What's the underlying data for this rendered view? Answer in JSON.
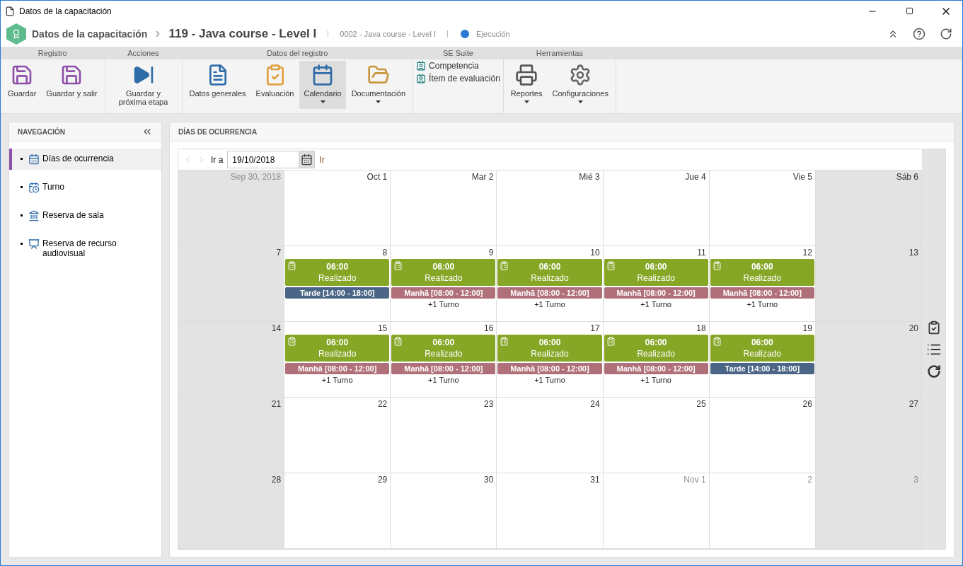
{
  "window": {
    "title": "Datos de la capacitación"
  },
  "header": {
    "breadcrumb": "Datos de la capacitación",
    "title": "119 - Java course - Level I",
    "code": "0002 - Java course - Level I",
    "stage": "Ejecución"
  },
  "ribbon": [
    {
      "label": "Registro",
      "items": [
        {
          "kind": "button",
          "label": "Guardar",
          "selected": false,
          "dropdown": false
        },
        {
          "kind": "button",
          "label": "Guardar y salir",
          "selected": false,
          "dropdown": false
        }
      ]
    },
    {
      "label": "Acciones",
      "items": [
        {
          "kind": "button",
          "label": "Guardar y próxima etapa",
          "selected": false,
          "dropdown": false
        }
      ]
    },
    {
      "label": "Datos del registro",
      "items": [
        {
          "kind": "button",
          "label": "Datos generales",
          "selected": false,
          "dropdown": false
        },
        {
          "kind": "button",
          "label": "Evaluación",
          "selected": false,
          "dropdown": false
        },
        {
          "kind": "button",
          "label": "Calendario",
          "selected": true,
          "dropdown": true
        },
        {
          "kind": "button",
          "label": "Documentación",
          "selected": false,
          "dropdown": true
        }
      ]
    },
    {
      "label": "SE Suite",
      "items": [
        {
          "kind": "link",
          "label": "Competencia"
        },
        {
          "kind": "link",
          "label": "Ítem de evaluación"
        }
      ]
    },
    {
      "label": "Herramientas",
      "items": [
        {
          "kind": "button",
          "label": "Reportes",
          "selected": false,
          "dropdown": true
        },
        {
          "kind": "button",
          "label": "Configuraciones",
          "selected": false,
          "dropdown": true
        }
      ]
    }
  ],
  "navigation": {
    "title": "NAVEGACIÓN",
    "items": [
      {
        "label": "Días de ocurrencia",
        "selected": true
      },
      {
        "label": "Turno",
        "selected": false
      },
      {
        "label": "Reserva de sala",
        "selected": false
      },
      {
        "label": "Reserva de recurso audiovisual",
        "selected": false
      }
    ]
  },
  "calendar": {
    "title": "DÍAS DE OCURRENCIA",
    "goto_label": "Ir a",
    "date": "19/10/2018",
    "go": "Ir",
    "weeks": [
      [
        {
          "label": "Sep 30, 2018",
          "outside": true,
          "weekend": true
        },
        {
          "label": "Oct 1",
          "outside": false,
          "weekend": false
        },
        {
          "label": "Mar 2",
          "outside": false,
          "weekend": false
        },
        {
          "label": "Mié 3",
          "outside": false,
          "weekend": false
        },
        {
          "label": "Jue 4",
          "outside": false,
          "weekend": false
        },
        {
          "label": "Vie 5",
          "outside": false,
          "weekend": false
        },
        {
          "label": "Sáb 6",
          "outside": false,
          "weekend": true
        }
      ],
      [
        {
          "label": "7",
          "outside": false,
          "weekend": true
        },
        {
          "label": "8",
          "outside": false,
          "weekend": false,
          "activity": {
            "time": "06:00",
            "status": "Realizado"
          },
          "shifts": [
            {
              "label": "Tarde [14:00 - 18:00]",
              "color": "#4a6585"
            }
          ]
        },
        {
          "label": "9",
          "outside": false,
          "weekend": false,
          "activity": {
            "time": "06:00",
            "status": "Realizado"
          },
          "shifts": [
            {
              "label": "Manhã [08:00 - 12:00]",
              "color": "#b0707a"
            }
          ],
          "more": "+1 Turno"
        },
        {
          "label": "10",
          "outside": false,
          "weekend": false,
          "activity": {
            "time": "06:00",
            "status": "Realizado"
          },
          "shifts": [
            {
              "label": "Manhã [08:00 - 12:00]",
              "color": "#b0707a"
            }
          ],
          "more": "+1 Turno"
        },
        {
          "label": "11",
          "outside": false,
          "weekend": false,
          "activity": {
            "time": "06:00",
            "status": "Realizado"
          },
          "shifts": [
            {
              "label": "Manhã [08:00 - 12:00]",
              "color": "#b0707a"
            }
          ],
          "more": "+1 Turno"
        },
        {
          "label": "12",
          "outside": false,
          "weekend": false,
          "activity": {
            "time": "06:00",
            "status": "Realizado"
          },
          "shifts": [
            {
              "label": "Manhã [08:00 - 12:00]",
              "color": "#b0707a"
            }
          ],
          "more": "+1 Turno"
        },
        {
          "label": "13",
          "outside": false,
          "weekend": true
        }
      ],
      [
        {
          "label": "14",
          "outside": false,
          "weekend": true
        },
        {
          "label": "15",
          "outside": false,
          "weekend": false,
          "activity": {
            "time": "06:00",
            "status": "Realizado"
          },
          "shifts": [
            {
              "label": "Manhã [08:00 - 12:00]",
              "color": "#b0707a"
            }
          ],
          "more": "+1 Turno"
        },
        {
          "label": "16",
          "outside": false,
          "weekend": false,
          "activity": {
            "time": "06:00",
            "status": "Realizado"
          },
          "shifts": [
            {
              "label": "Manhã [08:00 - 12:00]",
              "color": "#b0707a"
            }
          ],
          "more": "+1 Turno"
        },
        {
          "label": "17",
          "outside": false,
          "weekend": false,
          "activity": {
            "time": "06:00",
            "status": "Realizado"
          },
          "shifts": [
            {
              "label": "Manhã [08:00 - 12:00]",
              "color": "#b0707a"
            }
          ],
          "more": "+1 Turno"
        },
        {
          "label": "18",
          "outside": false,
          "weekend": false,
          "activity": {
            "time": "06:00",
            "status": "Realizado"
          },
          "shifts": [
            {
              "label": "Manhã [08:00 - 12:00]",
              "color": "#b0707a"
            }
          ],
          "more": "+1 Turno"
        },
        {
          "label": "19",
          "outside": false,
          "weekend": false,
          "activity": {
            "time": "06:00",
            "status": "Realizado"
          },
          "shifts": [
            {
              "label": "Tarde [14:00 - 18:00]",
              "color": "#4a6585"
            }
          ]
        },
        {
          "label": "20",
          "outside": false,
          "weekend": true
        }
      ],
      [
        {
          "label": "21",
          "outside": false,
          "weekend": true
        },
        {
          "label": "22",
          "outside": false,
          "weekend": false
        },
        {
          "label": "23",
          "outside": false,
          "weekend": false
        },
        {
          "label": "24",
          "outside": false,
          "weekend": false
        },
        {
          "label": "25",
          "outside": false,
          "weekend": false
        },
        {
          "label": "26",
          "outside": false,
          "weekend": false
        },
        {
          "label": "27",
          "outside": false,
          "weekend": true
        }
      ],
      [
        {
          "label": "28",
          "outside": false,
          "weekend": true
        },
        {
          "label": "29",
          "outside": false,
          "weekend": false
        },
        {
          "label": "30",
          "outside": false,
          "weekend": false
        },
        {
          "label": "31",
          "outside": false,
          "weekend": false
        },
        {
          "label": "Nov 1",
          "outside": true,
          "weekend": false
        },
        {
          "label": "2",
          "outside": true,
          "weekend": false
        },
        {
          "label": "3",
          "outside": true,
          "weekend": true
        }
      ]
    ]
  }
}
